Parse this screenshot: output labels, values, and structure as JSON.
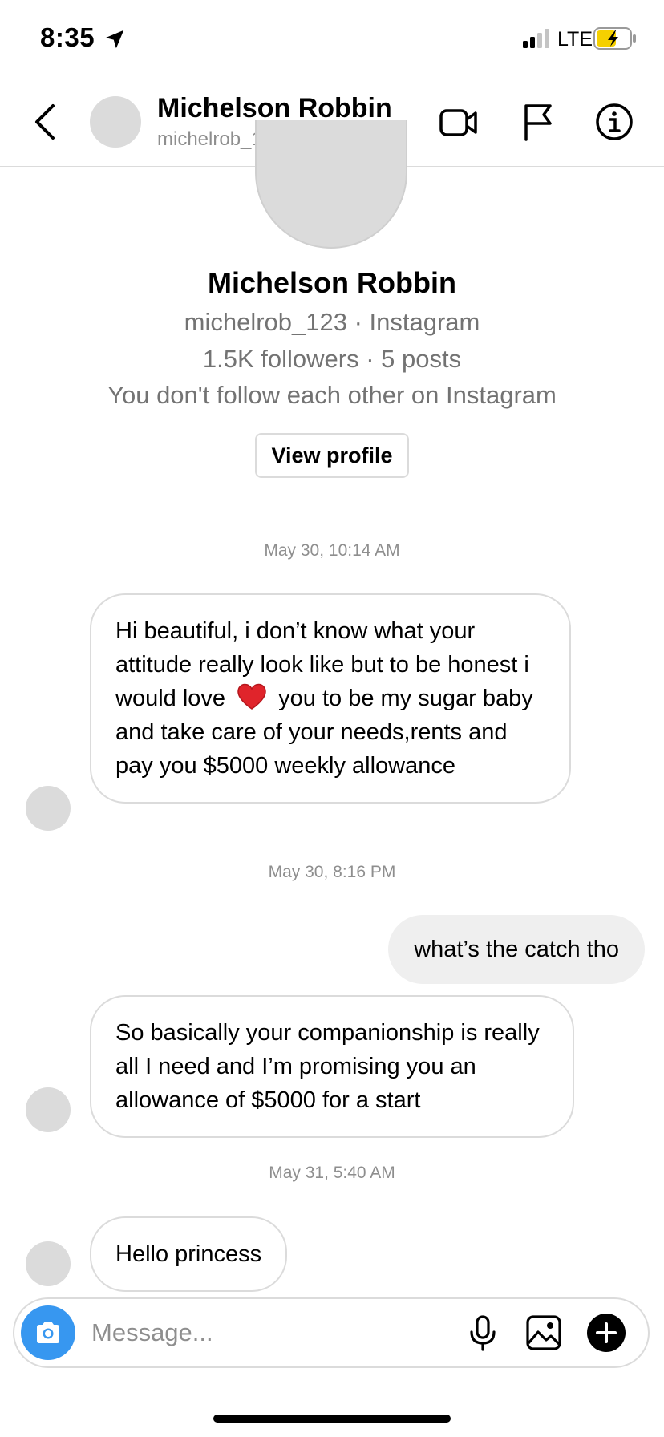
{
  "status_bar": {
    "time": "8:35",
    "network": "LTE",
    "location_icon": "location-arrow-icon",
    "signal_icon": "signal-bars-icon",
    "battery_icon": "battery-charging-icon"
  },
  "header": {
    "name": "Michelson Robbin",
    "username": "michelrob_123",
    "back_icon": "chevron-left-icon",
    "icons": [
      "video-call-icon",
      "flag-icon",
      "info-icon"
    ]
  },
  "profile": {
    "name": "Michelson Robbin",
    "handle_line": "michelrob_123 · Instagram",
    "stats_line": "1.5K followers · 5 posts",
    "follow_line": "You don't follow each other on Instagram",
    "view_profile_label": "View profile"
  },
  "messages": [
    {
      "timestamp": "May 30, 10:14 AM"
    },
    {
      "sender": "them",
      "text_before": "Hi beautiful, i don’t know what your attitude really look like but to be honest i would love",
      "text_after": "you to be my sugar baby and take care of your needs,rents and pay you $5000 weekly allowance",
      "emoji": "red-heart-icon"
    },
    {
      "timestamp": "May 30, 8:16 PM"
    },
    {
      "sender": "me",
      "text": "what’s the catch tho"
    },
    {
      "sender": "them",
      "text": "So basically your companionship is really all I need and I’m promising you an allowance of $5000 for a start"
    },
    {
      "timestamp": "May 31, 5:40 AM"
    },
    {
      "sender": "them",
      "text": "Hello princess"
    }
  ],
  "composer": {
    "placeholder": "Message...",
    "value": "",
    "icons": [
      "camera-icon",
      "microphone-icon",
      "image-icon",
      "plus-icon"
    ]
  },
  "colors": {
    "accent": "#3797f0",
    "bubble_out": "#efefef",
    "border": "#dbdbdb",
    "secondary_text": "#8e8e8e",
    "battery": "#f5d000"
  }
}
